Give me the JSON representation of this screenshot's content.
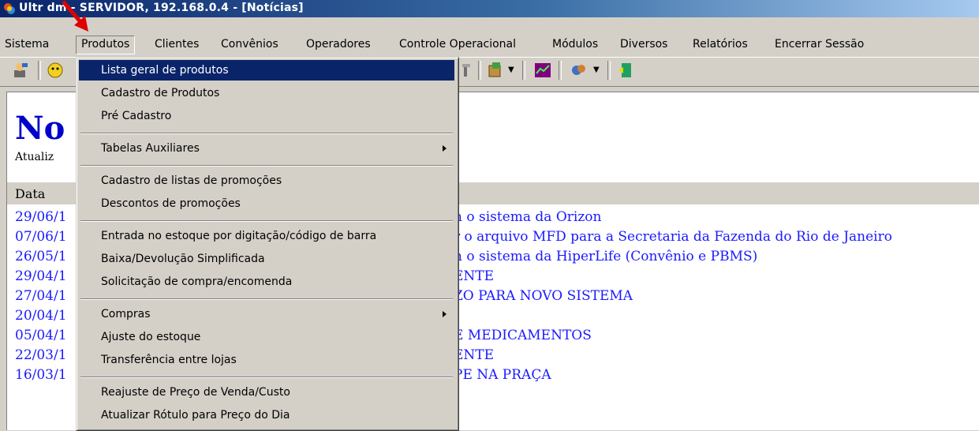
{
  "window": {
    "title": "UltraPdm - SERVIDOR, 192.168.0.4 - [Notícias]",
    "title_visible": "Ultr    dm - SERVIDOR, 192.168.0.4 - [Notícias]"
  },
  "menubar": {
    "items": [
      "Sistema",
      "Produtos",
      "Clientes",
      "Convênios",
      "Operadores",
      "Controle Operacional",
      "Módulos",
      "Diversos",
      "Relatórios",
      "Encerrar Sessão"
    ],
    "open_item": "Produtos"
  },
  "toolbar": {
    "icons": [
      "user-icon",
      "smiley-icon",
      "tool-icon",
      "box-icon",
      "chart-icon",
      "plugin-icon",
      "exit-icon"
    ]
  },
  "content": {
    "heading": "No",
    "subheading": "Atualiz",
    "column_header": "Data",
    "rows": [
      {
        "date": "29/06/1",
        "headline": "n o sistema da Orizon"
      },
      {
        "date": "07/06/1",
        "headline": "r o arquivo MFD para a Secretaria da Fazenda do Rio de Janeiro"
      },
      {
        "date": "26/05/1",
        "headline": "n o sistema da HiperLife (Convênio e PBMS)"
      },
      {
        "date": "29/04/1",
        "headline": "ENTE"
      },
      {
        "date": "27/04/1",
        "headline": "ZO PARA NOVO SISTEMA"
      },
      {
        "date": "20/04/1",
        "headline": ""
      },
      {
        "date": "05/04/1",
        "headline": "E MEDICAMENTOS"
      },
      {
        "date": "22/03/1",
        "headline": "ENTE"
      },
      {
        "date": "16/03/1",
        "headline": "PE NA PRAÇA"
      }
    ]
  },
  "dropdown": {
    "items": [
      {
        "label": "Lista geral de produtos",
        "active": true
      },
      {
        "label": "Cadastro de Produtos"
      },
      {
        "label": "Pré Cadastro"
      },
      {
        "sep": true
      },
      {
        "label": "Tabelas Auxiliares",
        "submenu": true
      },
      {
        "sep": true
      },
      {
        "label": "Cadastro de listas de promoções"
      },
      {
        "label": "Descontos de promoções"
      },
      {
        "sep": true
      },
      {
        "label": "Entrada no estoque por digitação/código de barra"
      },
      {
        "label": "Baixa/Devolução Simplificada"
      },
      {
        "label": "Solicitação de compra/encomenda"
      },
      {
        "sep": true
      },
      {
        "label": "Compras",
        "submenu": true
      },
      {
        "label": "Ajuste do estoque"
      },
      {
        "label": "Transferência entre lojas"
      },
      {
        "sep": true
      },
      {
        "label": "Reajuste de Preço de Venda/Custo"
      },
      {
        "label": "Atualizar Rótulo para Preço do Dia"
      }
    ]
  },
  "colors": {
    "titlebar": "#0a246a",
    "highlight": "#0a246a",
    "link": "#1a1aff",
    "heading": "#0000cc",
    "annotation": "#e00000"
  }
}
